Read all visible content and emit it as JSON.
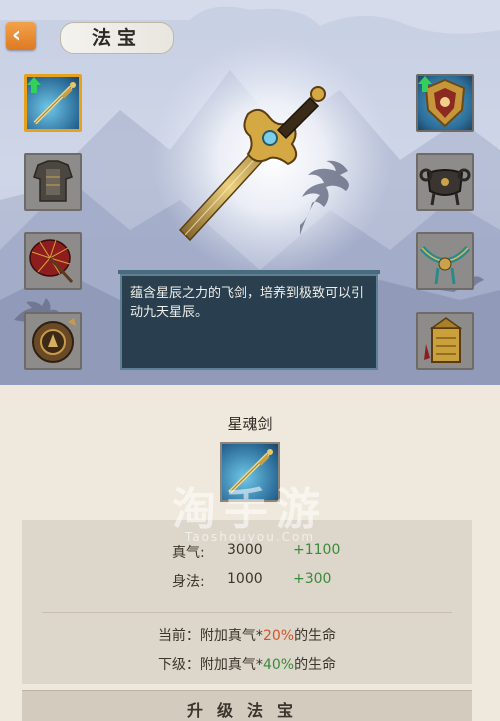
{
  "header": {
    "title": "法宝",
    "back_icon": "chevron-left-icon"
  },
  "colors": {
    "accent": "#e7a21d",
    "back_button": "#e68a2e",
    "bonus_green": "#3a8b3a",
    "current_pct": "#d4552a"
  },
  "left_slots": [
    {
      "icon": "sword-icon",
      "selected": true,
      "upgrade": true
    },
    {
      "icon": "armor-icon",
      "selected": false,
      "upgrade": false
    },
    {
      "icon": "umbrella-icon",
      "selected": false,
      "upgrade": false
    },
    {
      "icon": "mirror-icon",
      "selected": false,
      "upgrade": false
    }
  ],
  "right_slots": [
    {
      "icon": "shield-icon",
      "selected": false,
      "upgrade": true
    },
    {
      "icon": "cauldron-icon",
      "selected": false,
      "upgrade": false
    },
    {
      "icon": "necklace-icon",
      "selected": false,
      "upgrade": false
    },
    {
      "icon": "seal-icon",
      "selected": false,
      "upgrade": false
    }
  ],
  "description": "蕴含星辰之力的飞剑，培养到极致可以引动九天星辰。",
  "item": {
    "name": "星魂剑",
    "icon": "sword-icon"
  },
  "watermark": {
    "main": "淘手游",
    "sub": "Taoshouyou.Com"
  },
  "stats": [
    {
      "label": "真气:",
      "value": "3000",
      "bonus": "+1100"
    },
    {
      "label": "身法:",
      "value": "1000",
      "bonus": "+300"
    }
  ],
  "effects": {
    "current_prefix": "当前：附加真气*",
    "current_pct": "20%",
    "current_suffix": "的生命",
    "next_prefix": "下级：附加真气*",
    "next_pct": "40%",
    "next_suffix": "的生命"
  },
  "bottom_button": {
    "label": "升级法宝"
  }
}
